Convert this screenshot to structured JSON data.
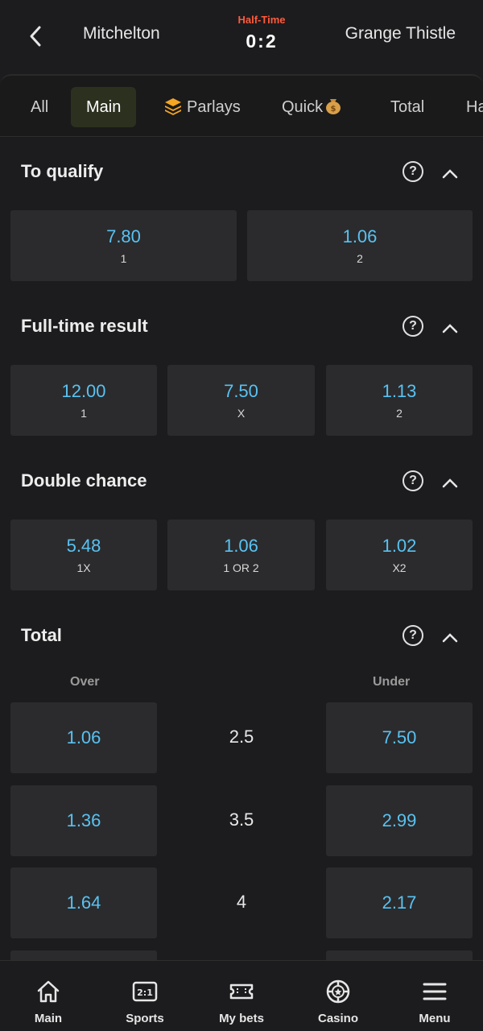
{
  "header": {
    "home_team": "Mitchelton",
    "away_team": "Grange Thistle",
    "status": "Half-Time",
    "score": "0:2"
  },
  "tabs": [
    {
      "label": "All"
    },
    {
      "label": "Main"
    },
    {
      "label": "Parlays"
    },
    {
      "label": "Quick"
    },
    {
      "label": "Total"
    },
    {
      "label": "Ha"
    }
  ],
  "markets": {
    "to_qualify": {
      "title": "To qualify",
      "odds": [
        {
          "value": "7.80",
          "label": "1"
        },
        {
          "value": "1.06",
          "label": "2"
        }
      ]
    },
    "full_time_result": {
      "title": "Full-time result",
      "odds": [
        {
          "value": "12.00",
          "label": "1"
        },
        {
          "value": "7.50",
          "label": "X"
        },
        {
          "value": "1.13",
          "label": "2"
        }
      ]
    },
    "double_chance": {
      "title": "Double chance",
      "odds": [
        {
          "value": "5.48",
          "label": "1X"
        },
        {
          "value": "1.06",
          "label": "1 OR 2"
        },
        {
          "value": "1.02",
          "label": "X2"
        }
      ]
    },
    "total": {
      "title": "Total",
      "over_label": "Over",
      "under_label": "Under",
      "rows": [
        {
          "over": "1.06",
          "line": "2.5",
          "under": "7.50"
        },
        {
          "over": "1.36",
          "line": "3.5",
          "under": "2.99"
        },
        {
          "over": "1.64",
          "line": "4",
          "under": "2.17"
        }
      ]
    }
  },
  "bottom_nav": [
    {
      "label": "Main",
      "icon": "home-icon"
    },
    {
      "label": "Sports",
      "icon": "scoreboard-icon"
    },
    {
      "label": "My bets",
      "icon": "ticket-icon"
    },
    {
      "label": "Casino",
      "icon": "casino-chip-icon"
    },
    {
      "label": "Menu",
      "icon": "menu-icon"
    }
  ],
  "colors": {
    "background": "#1c1c1e",
    "card": "#2b2b2d",
    "odds_value": "#59c2f2",
    "status": "#ff5a3c",
    "active_tab": "#2c311f",
    "parlays_icon": "#f5a623"
  }
}
